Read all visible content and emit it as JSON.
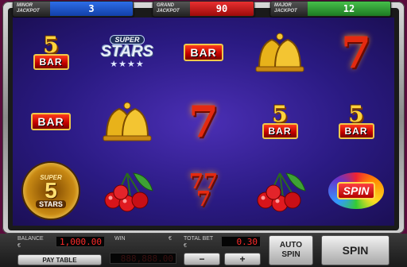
{
  "jackpots": {
    "minor": {
      "label_top": "MINOR",
      "label_bottom": "JACKPOT",
      "value": "3"
    },
    "grand": {
      "label_top": "GRAND",
      "label_bottom": "JACKPOT",
      "value": "90"
    },
    "major": {
      "label_top": "MAJOR",
      "label_bottom": "JACKPOT",
      "value": "12"
    }
  },
  "symbols": {
    "bar": "BAR",
    "five": "5",
    "seven": "7",
    "super": "SUPER",
    "stars": "STARS",
    "star_row": "★★★★",
    "spin": "SPIN"
  },
  "panel": {
    "balance_label": "BALANCE",
    "currency": "€",
    "balance_value": "1,000.00",
    "win_label": "WIN",
    "win_value": "888,888.00",
    "total_bet_label": "TOTAL BET",
    "total_bet_value": "0.30",
    "minus": "−",
    "plus": "+",
    "pay_table": "PAY TABLE",
    "auto_spin": "AUTO SPIN",
    "spin": "SPIN"
  }
}
